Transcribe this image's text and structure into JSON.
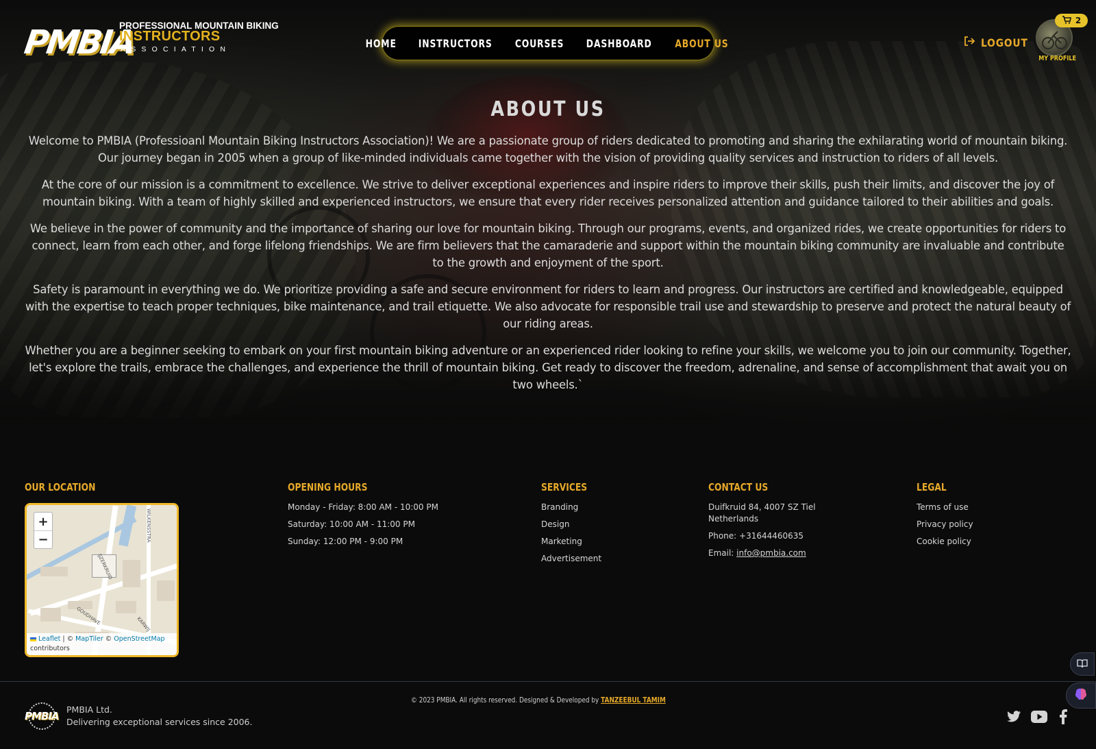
{
  "brand": {
    "mark": "PMBIA",
    "line1": "PROFESSIONAL MOUNTAIN BIKING",
    "line2": "INSTRUCTORS",
    "line3": "ASSOCIATION"
  },
  "nav": {
    "items": [
      {
        "label": "HOME"
      },
      {
        "label": "INSTRUCTORS"
      },
      {
        "label": "COURSES"
      },
      {
        "label": "DASHBOARD"
      },
      {
        "label": "ABOUT US",
        "active": true
      }
    ]
  },
  "header": {
    "logout_label": "LOGOUT",
    "profile_label": "MY PROFILE",
    "cart_count": "2"
  },
  "about": {
    "title": "ABOUT US",
    "paragraphs": [
      "Welcome to PMBIA (Professioanl Mountain Biking Instructors Association)! We are a passionate group of riders dedicated to promoting and sharing the exhilarating world of mountain biking. Our journey began in 2005 when a group of like-minded individuals came together with the vision of providing quality services and instruction to riders of all levels.",
      "At the core of our mission is a commitment to excellence. We strive to deliver exceptional experiences and inspire riders to improve their skills, push their limits, and discover the joy of mountain biking. With a team of highly skilled and experienced instructors, we ensure that every rider receives personalized attention and guidance tailored to their abilities and goals.",
      "We believe in the power of community and the importance of sharing our love for mountain biking. Through our programs, events, and organized rides, we create opportunities for riders to connect, learn from each other, and forge lifelong friendships. We are firm believers that the camaraderie and support within the mountain biking community are invaluable and contribute to the growth and enjoyment of the sport.",
      "Safety is paramount in everything we do. We prioritize providing a safe and secure environment for riders to learn and progress. Our instructors are certified and knowledgeable, equipped with the expertise to teach proper techniques, bike maintenance, and trail etiquette. We also advocate for responsible trail use and stewardship to preserve and protect the natural beauty of our riding areas.",
      "Whether you are a beginner seeking to embark on your first mountain biking adventure or an experienced rider looking to refine your skills, we welcome you to join our community. Together, let's explore the trails, embrace the challenges, and experience the thrill of mountain biking. Get ready to discover the freedom, adrenaline, and sense of accomplishment that await you on two wheels.`"
    ]
  },
  "footer": {
    "location": {
      "heading": "OUR LOCATION",
      "zoom_in": "+",
      "zoom_out": "−",
      "attribution": {
        "leaflet": "Leaflet",
        "sep1": " | © ",
        "maptiler": "MapTiler",
        "sep2": " © ",
        "osm": "OpenStreetMap",
        "contrib": "contributors"
      },
      "street_labels": [
        "WILKENSSTRA",
        "GOUDHAVE",
        "KARWIJ",
        "IJZERKRUID"
      ]
    },
    "hours": {
      "heading": "OPENING HOURS",
      "items": [
        "Monday - Friday: 8:00 AM - 10:00 PM",
        "Saturday: 10:00 AM - 11:00 PM",
        "Sunday: 12:00 PM - 9:00 PM"
      ]
    },
    "services": {
      "heading": "SERVICES",
      "items": [
        "Branding",
        "Design",
        "Marketing",
        "Advertisement"
      ]
    },
    "contact": {
      "heading": "CONTACT US",
      "address1": "Duifkruid 84, 4007 SZ Tiel",
      "address2": "Netherlands",
      "phone": "Phone: +31644460635",
      "email_prefix": "Email: ",
      "email": "info@pmbia.com"
    },
    "legal": {
      "heading": "LEGAL",
      "items": [
        "Terms of use",
        "Privacy policy",
        "Cookie policy"
      ]
    },
    "bottom": {
      "logo_text": "PMBIA",
      "company": "PMBIA Ltd.",
      "tagline": "Delivering exceptional services since 2006.",
      "copyright": "© 2023 PMBIA. All rights reserved. Designed & Developed by ",
      "developer": "TANZEEBUL TAMIM"
    },
    "social": [
      "twitter-icon",
      "youtube-icon",
      "facebook-icon"
    ]
  },
  "colors": {
    "accent": "#e6a92a",
    "nav_glow": "#e4c81e",
    "map_border": "#f0b82a",
    "background": "#0b0b0b"
  }
}
